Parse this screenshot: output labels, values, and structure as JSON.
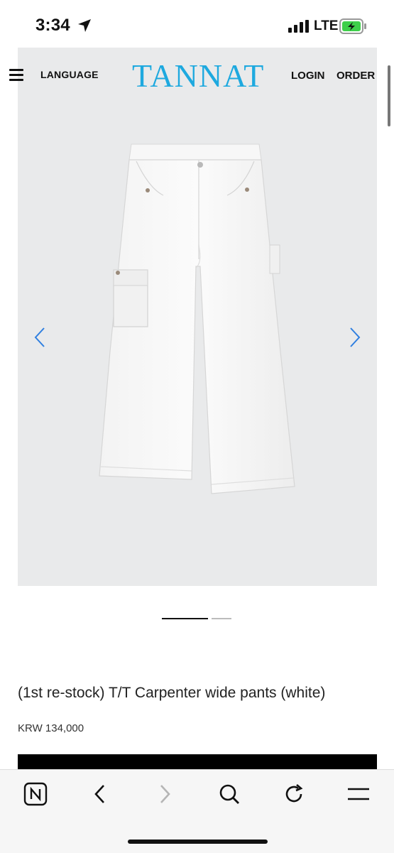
{
  "status_bar": {
    "time": "3:34",
    "network": "LTE",
    "icons": [
      "location-arrow-icon",
      "signal-bars-icon",
      "battery-charging-icon"
    ],
    "battery_color": "#3ecf4a"
  },
  "nav": {
    "language_label": "LANGUAGE",
    "logo_text": "TANNAT",
    "logo_color": "#1ea9df",
    "login_label": "LOGIN",
    "order_label": "ORDER"
  },
  "product": {
    "title": "(1st re-stock) T/T Carpenter wide pants (white)",
    "price": "KRW 134,000",
    "carousel": {
      "slide_count": 2,
      "active_index": 0
    }
  },
  "browser_toolbar": {
    "items": [
      "naver-home-icon",
      "back-icon",
      "forward-icon",
      "search-icon",
      "reload-icon",
      "menu-icon"
    ]
  }
}
